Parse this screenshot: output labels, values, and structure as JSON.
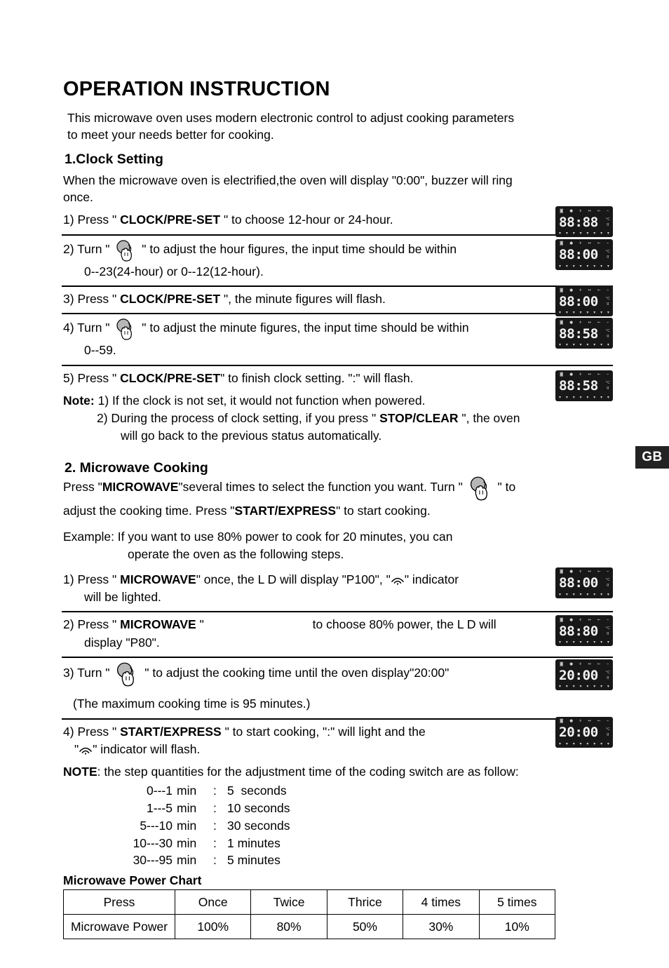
{
  "page": {
    "title": "OPERATION INSTRUCTION",
    "intro_line1": "This microwave oven uses modern electronic control to adjust cooking parameters",
    "intro_line2": "to meet your needs better for cooking.",
    "language_tab": "GB"
  },
  "clock_section": {
    "heading": "1.Clock Setting",
    "lead_line1": "When the microwave oven is electrified,the oven will display \"0:00\", buzzer will ring",
    "lead_line2": "once.",
    "steps": [
      {
        "number": "1)",
        "verb": "Press \"",
        "button": "CLOCK/PRE-SET",
        "tail": "\" to choose 12-hour or 24-hour.",
        "has_knob": false,
        "second_line": "",
        "display": "88:88"
      },
      {
        "number": "2)",
        "verb": "Turn \"",
        "button": "",
        "tail": "\" to adjust the hour figures, the input time should be within",
        "has_knob": true,
        "second_line": "0--23(24-hour) or 0--12(12-hour).",
        "display": "88:00"
      },
      {
        "number": "3)",
        "verb": "Press \"",
        "button": "CLOCK/PRE-SET",
        "tail": "\", the minute figures will flash.",
        "has_knob": false,
        "second_line": "",
        "display": "88:00"
      },
      {
        "number": "4)",
        "verb": "Turn \"",
        "button": "",
        "tail": "\" to adjust the minute figures, the input time should be within",
        "has_knob": true,
        "second_line": "0--59.",
        "display": "88:58"
      },
      {
        "number": "5)",
        "verb": "Press \"",
        "button": "CLOCK/PRE-SET",
        "tail": "\" to finish clock setting. \":\" will flash.",
        "has_knob": false,
        "second_line": "",
        "display": "88:58"
      }
    ],
    "note_label": "Note:",
    "note_1": "1) If the clock is not set, it would not function when powered.",
    "note_2_a": "2) During the process of clock setting, if you press \"",
    "note_2_button": "STOP/CLEAR",
    "note_2_b": "\", the oven",
    "note_2_c": "will go back to the previous status automatically."
  },
  "microwave_section": {
    "heading": "2. Microwave Cooking",
    "intro_a": "Press \"",
    "intro_button1": "MICROWAVE",
    "intro_b": "\"several times to select the function you want. Turn \"",
    "intro_c": "\" to",
    "intro_d": "adjust the cooking time. Press \"",
    "intro_button2": "START/EXPRESS",
    "intro_e": "\" to start cooking.",
    "example_line1": "Example: If you want to use 80% power to cook for 20 minutes, you can",
    "example_line2": "operate the oven as the following steps.",
    "steps": [
      {
        "number": "1)",
        "verb": "Press \"",
        "button": "MICROWAVE",
        "tail": "\" once, the L  D will display \"P100\", \"",
        "tail2": "\" indicator",
        "second_line": "will be lighted.",
        "has_wave": true,
        "has_knob": false,
        "display": "88:00"
      },
      {
        "number": "2)",
        "verb": "Press \"",
        "button": "MICROWAVE",
        "tail": "\"",
        "tail2": "to choose 80% power, the L  D will",
        "second_line": "display \"P80\".",
        "has_wave": false,
        "has_knob": false,
        "display": "88:80"
      },
      {
        "number": "3)",
        "verb": "Turn \"",
        "button": "",
        "tail": "\" to adjust the cooking time until the oven display\"20:00\"",
        "tail2": "",
        "second_line": "(The maximum cooking time is 95 minutes.)",
        "has_wave": false,
        "has_knob": true,
        "display": "20:00"
      },
      {
        "number": "4)",
        "verb": "Press \"",
        "button": "START/EXPRESS",
        "tail": "\" to start cooking, \":\" will light and the",
        "tail2": "",
        "second_line": "\"  \" indicator will flash.",
        "has_wave": false,
        "has_knob": false,
        "display": "20:00"
      }
    ],
    "note_label": "NOTE",
    "note_text": ":  the step quantities for the adjustment time of the coding switch are as follow:",
    "coding_switch": [
      {
        "range": "0---1",
        "unit": "min",
        "colon": ":",
        "value": "5  seconds"
      },
      {
        "range": "1---5",
        "unit": "min",
        "colon": ":",
        "value": "10 seconds"
      },
      {
        "range": "5---10",
        "unit": "min",
        "colon": ":",
        "value": "30 seconds"
      },
      {
        "range": "10---30",
        "unit": "min",
        "colon": ":",
        "value": "1 minutes"
      },
      {
        "range": "30---95",
        "unit": "min",
        "colon": ":",
        "value": "5 minutes"
      }
    ]
  },
  "power_chart": {
    "title": "Microwave Power Chart",
    "rows": [
      {
        "header": "Press",
        "cells": [
          "Once",
          "Twice",
          "Thrice",
          "4 times",
          "5 times"
        ]
      },
      {
        "header": "Microwave Power",
        "cells": [
          "100%",
          "80%",
          "50%",
          "30%",
          "10%"
        ]
      }
    ]
  },
  "led_panel": {
    "top_icons": [
      "wave-icon",
      "clock-icon",
      "pot-icon",
      "defrost-icon",
      "arrow-icon",
      "bar-icon"
    ],
    "unit_top": "°C",
    "unit_bottom": "g",
    "bottom_icons": [
      "v",
      "v",
      "v",
      "v",
      "v",
      "v",
      "v",
      "v"
    ],
    "background": "#181818",
    "digit_color": "#f2f2f2"
  }
}
